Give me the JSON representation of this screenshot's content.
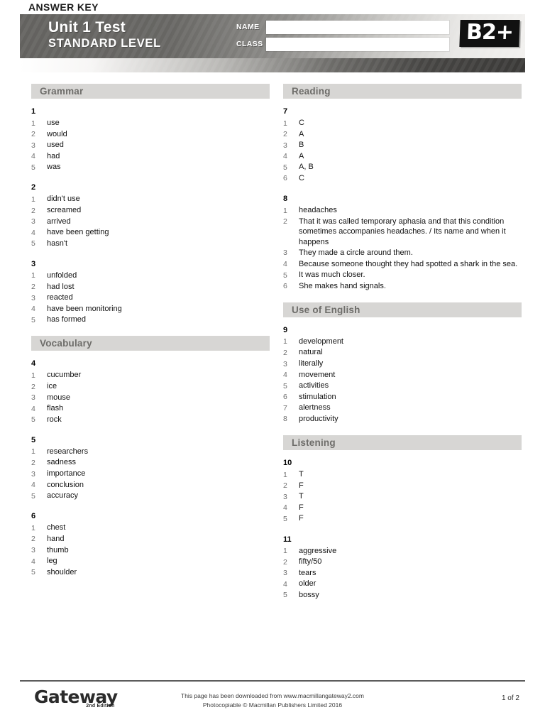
{
  "header": {
    "unit_title": "Unit 1 Test",
    "level_title": "STANDARD LEVEL",
    "answer_key_label": "ANSWER KEY",
    "name_label": "NAME",
    "class_label": "CLASS",
    "name_value": "",
    "class_value": "",
    "level_badge": "B2+",
    "badge_color": "#111111",
    "header_gradient_from": "#63625f",
    "header_gradient_to": "#f2f1ef"
  },
  "sections": [
    {
      "title": "Grammar",
      "column": "left",
      "exercises": [
        {
          "number": "1",
          "answers": [
            {
              "index": "1",
              "text": "use"
            },
            {
              "index": "2",
              "text": "would"
            },
            {
              "index": "3",
              "text": "used"
            },
            {
              "index": "4",
              "text": "had"
            },
            {
              "index": "5",
              "text": "was"
            }
          ]
        },
        {
          "number": "2",
          "answers": [
            {
              "index": "1",
              "text": "didn't use"
            },
            {
              "index": "2",
              "text": "screamed"
            },
            {
              "index": "3",
              "text": "arrived"
            },
            {
              "index": "4",
              "text": "have been getting"
            },
            {
              "index": "5",
              "text": "hasn't"
            }
          ]
        },
        {
          "number": "3",
          "answers": [
            {
              "index": "1",
              "text": "unfolded"
            },
            {
              "index": "2",
              "text": "had lost"
            },
            {
              "index": "3",
              "text": "reacted"
            },
            {
              "index": "4",
              "text": "have been monitoring"
            },
            {
              "index": "5",
              "text": "has formed"
            }
          ]
        }
      ]
    },
    {
      "title": "Vocabulary",
      "column": "left",
      "exercises": [
        {
          "number": "4",
          "answers": [
            {
              "index": "1",
              "text": "cucumber"
            },
            {
              "index": "2",
              "text": "ice"
            },
            {
              "index": "3",
              "text": "mouse"
            },
            {
              "index": "4",
              "text": "flash"
            },
            {
              "index": "5",
              "text": "rock"
            }
          ]
        },
        {
          "number": "5",
          "answers": [
            {
              "index": "1",
              "text": "researchers"
            },
            {
              "index": "2",
              "text": "sadness"
            },
            {
              "index": "3",
              "text": "importance"
            },
            {
              "index": "4",
              "text": "conclusion"
            },
            {
              "index": "5",
              "text": "accuracy"
            }
          ]
        },
        {
          "number": "6",
          "answers": [
            {
              "index": "1",
              "text": "chest"
            },
            {
              "index": "2",
              "text": "hand"
            },
            {
              "index": "3",
              "text": "thumb"
            },
            {
              "index": "4",
              "text": "leg"
            },
            {
              "index": "5",
              "text": "shoulder"
            }
          ]
        }
      ]
    },
    {
      "title": "Reading",
      "column": "right",
      "exercises": [
        {
          "number": "7",
          "answers": [
            {
              "index": "1",
              "text": "C"
            },
            {
              "index": "2",
              "text": "A"
            },
            {
              "index": "3",
              "text": "B"
            },
            {
              "index": "4",
              "text": "A"
            },
            {
              "index": "5",
              "text": "A, B"
            },
            {
              "index": "6",
              "text": "C"
            }
          ]
        },
        {
          "number": "8",
          "answers": [
            {
              "index": "1",
              "text": "headaches"
            },
            {
              "index": "2",
              "text": "That it was called temporary aphasia and that this condition sometimes accompanies headaches. / Its name and when it happens"
            },
            {
              "index": "3",
              "text": "They made a circle around them."
            },
            {
              "index": "4",
              "text": "Because someone thought they had spotted a shark in the sea."
            },
            {
              "index": "5",
              "text": "It was much closer."
            },
            {
              "index": "6",
              "text": "She makes hand signals."
            }
          ]
        }
      ]
    },
    {
      "title": "Use of English",
      "column": "right",
      "exercises": [
        {
          "number": "9",
          "answers": [
            {
              "index": "1",
              "text": "development"
            },
            {
              "index": "2",
              "text": "natural"
            },
            {
              "index": "3",
              "text": "literally"
            },
            {
              "index": "4",
              "text": "movement"
            },
            {
              "index": "5",
              "text": "activities"
            },
            {
              "index": "6",
              "text": "stimulation"
            },
            {
              "index": "7",
              "text": "alertness"
            },
            {
              "index": "8",
              "text": "productivity"
            }
          ]
        }
      ]
    },
    {
      "title": "Listening",
      "column": "right",
      "exercises": [
        {
          "number": "10",
          "answers": [
            {
              "index": "1",
              "text": "T"
            },
            {
              "index": "2",
              "text": "F"
            },
            {
              "index": "3",
              "text": "T"
            },
            {
              "index": "4",
              "text": "F"
            },
            {
              "index": "5",
              "text": "F"
            }
          ]
        },
        {
          "number": "11",
          "answers": [
            {
              "index": "1",
              "text": "aggressive"
            },
            {
              "index": "2",
              "text": "fifty/50"
            },
            {
              "index": "3",
              "text": "tears"
            },
            {
              "index": "4",
              "text": "older"
            },
            {
              "index": "5",
              "text": "bossy"
            }
          ]
        }
      ]
    }
  ],
  "footer": {
    "logo_name": "Gateway",
    "logo_edition": "2nd Edition",
    "line1": "This page has been downloaded from www.macmillangateway2.com",
    "line2": "Photocopiable © Macmillan Publishers Limited 2016",
    "page_number": "1 of 2"
  }
}
